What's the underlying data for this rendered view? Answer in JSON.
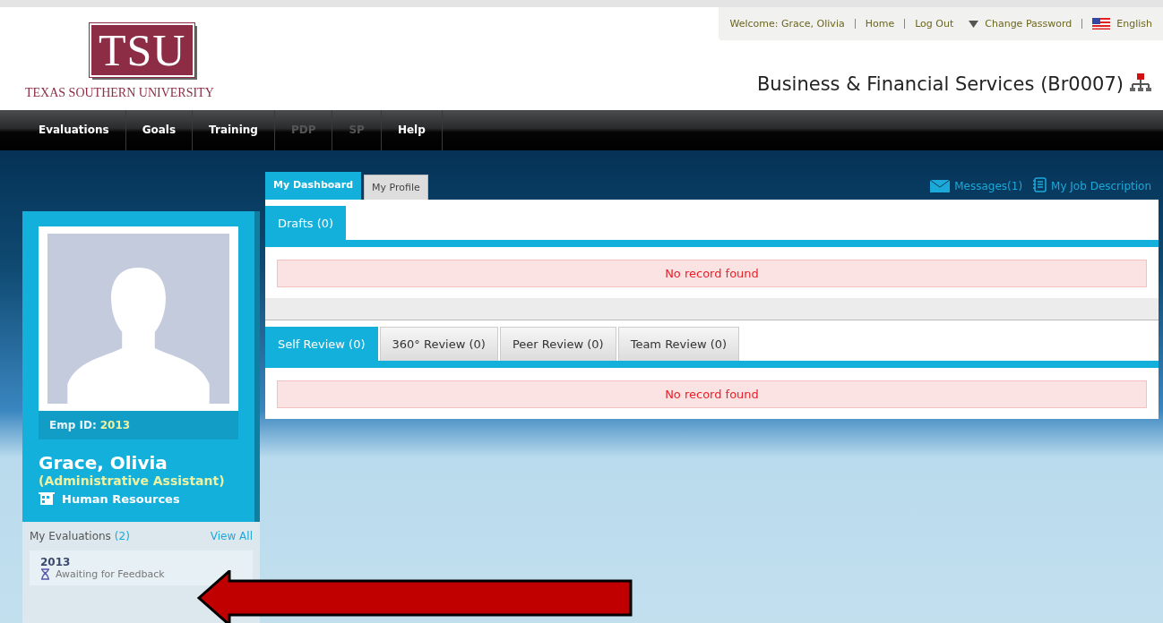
{
  "header": {
    "logo": "TSU",
    "university": "TEXAS SOUTHERN UNIVERSITY",
    "unit_title": "Business & Financial Services (Br0007)"
  },
  "top_links": [
    {
      "kind": "text",
      "label": "Welcome: Grace, Olivia"
    },
    {
      "kind": "link",
      "label": "Home"
    },
    {
      "kind": "link",
      "label": "Log Out"
    },
    {
      "kind": "dropdown",
      "label": "Change Password"
    },
    {
      "kind": "language",
      "label": "English"
    }
  ],
  "nav": [
    {
      "label": "Evaluations",
      "disabled": false
    },
    {
      "label": "Goals",
      "disabled": false
    },
    {
      "label": "Training",
      "disabled": false
    },
    {
      "label": "PDP",
      "disabled": true
    },
    {
      "label": "SP",
      "disabled": true
    },
    {
      "label": "Help",
      "disabled": false
    }
  ],
  "profile": {
    "emp_id_label": "Emp ID:",
    "emp_id": "2013",
    "name": "Grace, Olivia",
    "title": "(Administrative Assistant)",
    "department": "Human Resources"
  },
  "evaluations": {
    "heading": "My Evaluations",
    "count": "(2)",
    "view_all": "View All",
    "items": [
      {
        "year": "2013",
        "status": "Awaiting for Feedback"
      }
    ]
  },
  "tabs": [
    {
      "label": "My Dashboard",
      "selected": true
    },
    {
      "label": "My Profile",
      "selected": false
    }
  ],
  "quick_links": [
    {
      "kind": "messages",
      "label": "Messages(1)"
    },
    {
      "kind": "job",
      "label": "My Job Description"
    }
  ],
  "sections": [
    {
      "tabs": [
        {
          "label": "Drafts (0)",
          "selected": true
        }
      ],
      "message": "No record found"
    },
    {
      "tabs": [
        {
          "label": "Self Review (0)",
          "selected": true
        },
        {
          "label": "360° Review (0)",
          "selected": false
        },
        {
          "label": "Peer Review (0)",
          "selected": false
        },
        {
          "label": "Team Review (0)",
          "selected": false
        }
      ],
      "message": "No record found"
    }
  ]
}
